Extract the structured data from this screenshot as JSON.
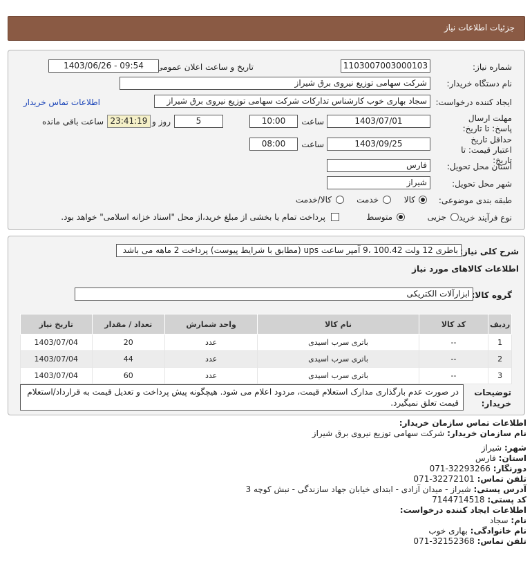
{
  "header": {
    "title": "جزئیات اطلاعات نیاز"
  },
  "form": {
    "need_number_label": "شماره نیاز:",
    "need_number": "1103007003000103",
    "announce_label": "تاریخ و ساعت اعلان عمومی:",
    "announce_value": "1403/06/26 - 09:54",
    "buyer_label": "نام دستگاه خریدار:",
    "buyer_value": "شرکت سهامی توزیع نیروی برق شیراز",
    "creator_label": "ایجاد کننده درخواست:",
    "creator_value": "سجاد بهاری خوب کارشناس تدارکات شرکت سهامی توزیع نیروی برق شیراز",
    "contact_link": "اطلاعات تماس خریدار",
    "deadline_label": "مهلت ارسال پاسخ: تا تاریخ:",
    "deadline_date": "1403/07/01",
    "time_label": "ساعت",
    "deadline_time": "10:00",
    "days_value": "5",
    "days_label": "روز و",
    "remaining_value": "23:41:19",
    "remaining_label": "ساعت باقی مانده",
    "validity_label": "حداقل تاریخ اعتبار قیمت: تا تاریخ:",
    "validity_date": "1403/09/25",
    "validity_time_label": "ساعت",
    "validity_time": "08:00",
    "province_label": "استان محل تحویل:",
    "province_value": "فارس",
    "city_label": "شهر محل تحویل:",
    "city_value": "شیراز",
    "category_label": "طبقه بندی موضوعی:",
    "category_options": [
      "کالا",
      "خدمت",
      "کالا/خدمت"
    ],
    "category_selected": "کالا",
    "process_label": "نوع فرآیند خرید :",
    "process_options": [
      "جزیی",
      "متوسط"
    ],
    "process_selected": "متوسط",
    "process_note": "پرداخت تمام یا بخشی از مبلغ خرید،از محل \"اسناد خزانه اسلامی\" خواهد بود."
  },
  "description": {
    "label": "شرح کلی نیاز:",
    "value": "باطری 12 ولت 100.42 ،9 آمپر ساعت ups (مطابق با شرایط پیوست) پرداخت 2 ماهه می باشد"
  },
  "goods": {
    "section_title": "اطلاعات کالاهای مورد نیاز",
    "group_label": "گروه کالا:",
    "group_value": "ابزارآلات الکتریکی",
    "columns": [
      "ردیف",
      "کد کالا",
      "نام کالا",
      "واحد شمارش",
      "تعداد / مقدار",
      "تاریخ نیاز"
    ],
    "rows": [
      {
        "row": "1",
        "code": "--",
        "name": "باتری سرب اسیدی",
        "unit": "عدد",
        "qty": "20",
        "date": "1403/07/04"
      },
      {
        "row": "2",
        "code": "--",
        "name": "باتری سرب اسیدی",
        "unit": "عدد",
        "qty": "44",
        "date": "1403/07/04"
      },
      {
        "row": "3",
        "code": "--",
        "name": "باتری سرب اسیدی",
        "unit": "عدد",
        "qty": "60",
        "date": "1403/07/04"
      }
    ]
  },
  "buyer_notes": {
    "label": "توضیحات خریدار:",
    "text": "در صورت عدم بارگذاری مدارک استعلام قیمت، مردود اعلام می شود. هیچگونه پیش پرداخت و تعدیل قیمت به قرارداد/استعلام قیمت تعلق نمیگیرد."
  },
  "contact": {
    "title": "اطلاعات تماس سازمان خریدار:",
    "org_label": "نام سازمان خریدار:",
    "org_value": "شرکت سهامی توزیع نیروی برق شیراز",
    "city_label": "شهر:",
    "city_value": "شیراز",
    "province_label": "استان:",
    "province_value": "فارس",
    "fax_label": "دورنگار:",
    "fax_value": "071-32293266",
    "phone_label": "تلفن تماس:",
    "phone_value": "071-32272101",
    "address_label": "آدرس پستی:",
    "address_value": "شیراز - میدان آزادی - ابتدای خیابان جهاد سازندگی - نبش کوچه 3",
    "postal_label": "کد پستی:",
    "postal_value": "7144714518",
    "creator_title": "اطلاعات ایجاد کننده درخواست:",
    "name_label": "نام:",
    "name_value": "سجاد",
    "family_label": "نام خانوادگی:",
    "family_value": "بهاری خوب",
    "creator_phone_label": "تلفن تماس:",
    "creator_phone_value": "071-32152368"
  }
}
